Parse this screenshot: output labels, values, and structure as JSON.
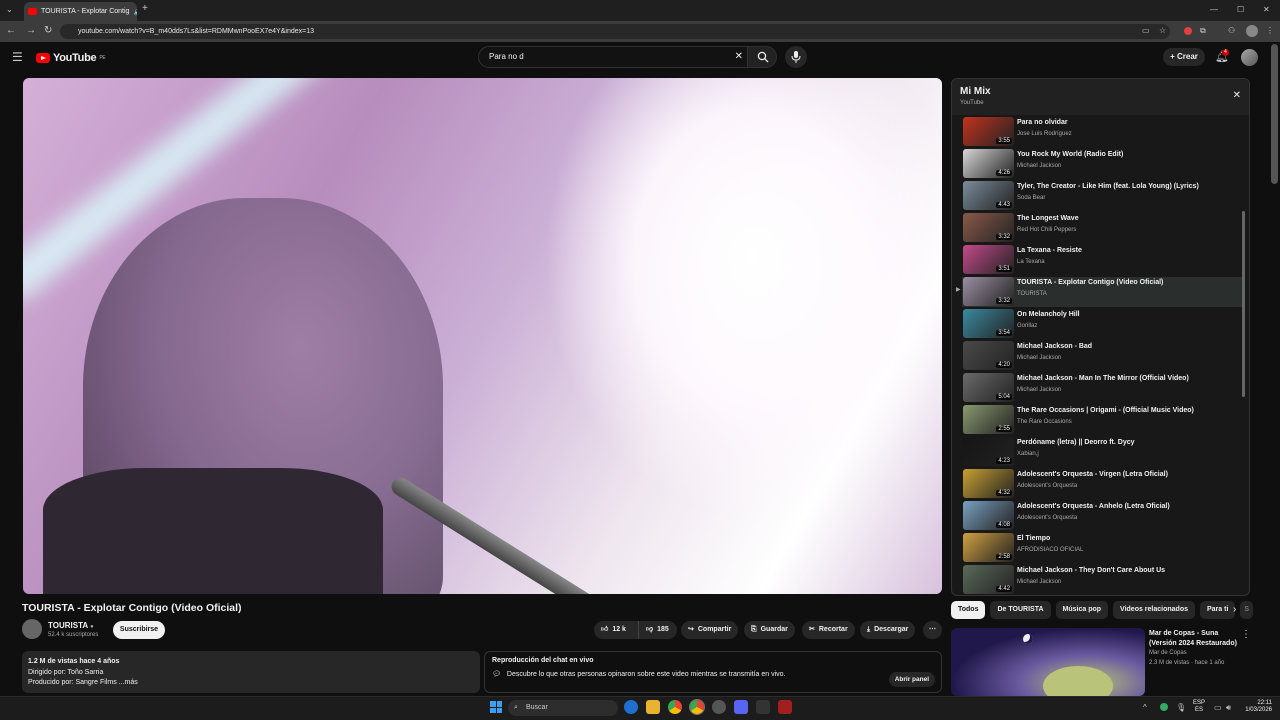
{
  "browser": {
    "tab_title": "TOURISTA - Explotar Contig",
    "url": "youtube.com/watch?v=B_m40dds7Ls&list=RDMMwnPooEX7e4Y&index=13"
  },
  "yt": {
    "logo": "YouTube",
    "region": "PE",
    "search_value": "Para no d",
    "create_label": "Crear",
    "notif_count": "4"
  },
  "video": {
    "title": "TOURISTA - Explotar Contigo (Video Oficial)",
    "channel": "TOURISTA",
    "subscribers": "52.4 k suscriptores",
    "subscribe_label": "Suscribirse",
    "likes": "12 k",
    "dislikes": "185",
    "share": "Compartir",
    "save": "Guardar",
    "clip": "Recortar",
    "download": "Descargar",
    "desc_line1": "1.2 M de vistas  hace 4 años",
    "desc_line2": "Dirigido por: Toño Sarria",
    "desc_line3": "Producido por: Sangre Films ...más",
    "chat_title": "Reproducción del chat en vivo",
    "chat_text": "Descubre lo que otras personas opinaron sobre este video mientras se transmitía en vivo.",
    "chat_button": "Abrir panel"
  },
  "mix": {
    "title": "Mi Mix",
    "subtitle": "YouTube",
    "items": [
      {
        "title": "Para no olvidar",
        "channel": "Jose Luis Rodríguez",
        "duration": "3:55",
        "color": "#c2331e"
      },
      {
        "title": "You Rock My World (Radio Edit)",
        "channel": "Michael Jackson",
        "duration": "4:26",
        "color": "#d8d8d8"
      },
      {
        "title": "Tyler, The Creator - Like Him (feat. Lola Young) (Lyrics)",
        "channel": "Soda Bear",
        "duration": "4:43",
        "color": "#7a8c99"
      },
      {
        "title": "The Longest Wave",
        "channel": "Red Hot Chili Peppers",
        "duration": "3:32",
        "color": "#8a5a4a"
      },
      {
        "title": "La Texana - Resiste",
        "channel": "La Texana",
        "duration": "3:51",
        "color": "#c44a8a"
      },
      {
        "title": "TOURISTA - Explotar Contigo (Video Oficial)",
        "channel": "TOURISTA",
        "duration": "3:32",
        "color": "#9c8fa3"
      },
      {
        "title": "On Melancholy Hill",
        "channel": "Gorillaz",
        "duration": "3:54",
        "color": "#3a8aa0"
      },
      {
        "title": "Michael Jackson - Bad",
        "channel": "Michael Jackson",
        "duration": "4:20",
        "color": "#4a4a4a"
      },
      {
        "title": "Michael Jackson - Man In The Mirror (Official Video)",
        "channel": "Michael Jackson",
        "duration": "5:04",
        "color": "#6a6a6a"
      },
      {
        "title": "The Rare Occasions | Origami - (Official Music Video)",
        "channel": "The Rare Occasions",
        "duration": "2:55",
        "color": "#8a9a70"
      },
      {
        "title": "Perdóname (letra) || Deorro ft. Dycy",
        "channel": "Xabian,j",
        "duration": "4:23",
        "color": "#151515"
      },
      {
        "title": "Adolescent's Orquesta - Virgen (Letra Oficial)",
        "channel": "Adolescent's Orquesta",
        "duration": "4:32",
        "color": "#c8a030"
      },
      {
        "title": "Adolescent's Orquesta - Anhelo (Letra Oficial)",
        "channel": "Adolescent's Orquesta",
        "duration": "4:08",
        "color": "#7aa0c0"
      },
      {
        "title": "El Tiempo",
        "channel": "AFRODISIACO OFICIAL",
        "duration": "2:58",
        "color": "#d0a040"
      },
      {
        "title": "Michael Jackson - They Don't Care About Us",
        "channel": "Michael Jackson",
        "duration": "4:42",
        "color": "#5a6a5a"
      }
    ]
  },
  "chips": [
    "Todos",
    "De TOURISTA",
    "Música pop",
    "Videos relacionados",
    "Para ti",
    "S"
  ],
  "related": {
    "title": "Mar de Copas - Suna (Versión 2024 Restaurado)",
    "channel": "Mar de Copas",
    "meta": "2.3 M de vistas · hace 1 año"
  },
  "taskbar": {
    "search": "Buscar",
    "lang": "ESP",
    "lang2": "ES",
    "time": "22:11",
    "date": "1/03/2026"
  }
}
